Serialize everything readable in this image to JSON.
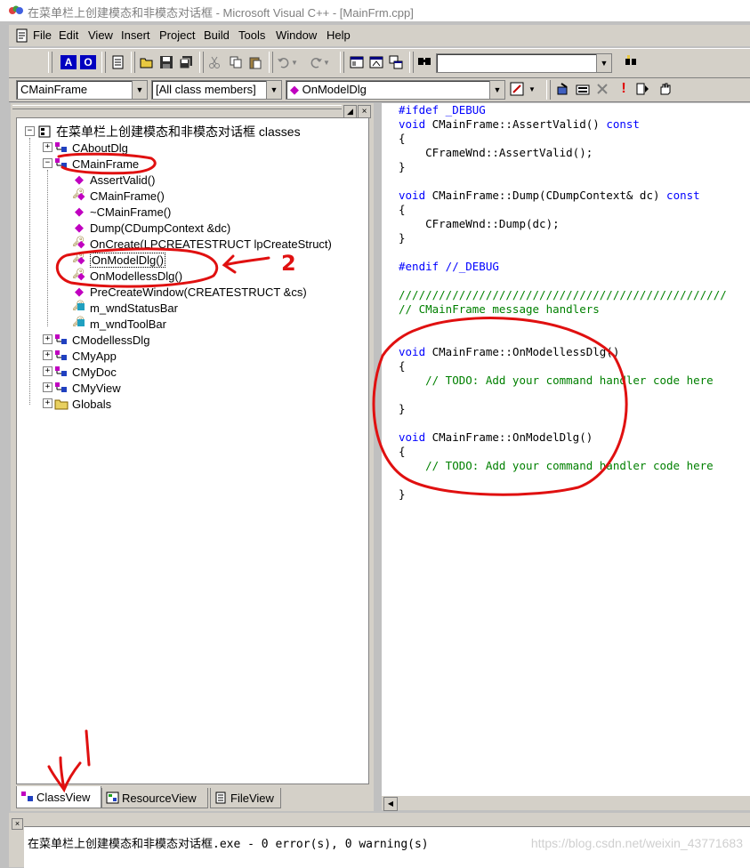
{
  "window": {
    "title": "在菜单栏上创建模态和非模态对话框 - Microsoft Visual C++ - [MainFrm.cpp]"
  },
  "menubar": {
    "items": [
      "File",
      "Edit",
      "View",
      "Insert",
      "Project",
      "Build",
      "Tools",
      "Window",
      "Help"
    ]
  },
  "wizardbar": {
    "class_combo": "CMainFrame",
    "filter_combo": "[All class members]",
    "member_combo": "OnModelDlg"
  },
  "tree": {
    "root": "在菜单栏上创建模态和非模态对话框 classes",
    "classes": {
      "about": "CAboutDlg",
      "mainframe": "CMainFrame",
      "modeless": "CModellessDlg",
      "app": "CMyApp",
      "doc": "CMyDoc",
      "view": "CMyView",
      "globals": "Globals"
    },
    "members": [
      "AssertValid()",
      "CMainFrame()",
      "~CMainFrame()",
      "Dump(CDumpContext &dc)",
      "OnCreate(LPCREATESTRUCT lpCreateStruct)",
      "OnModelDlg()",
      "OnModellessDlg()",
      "PreCreateWindow(CREATESTRUCT &cs)",
      "m_wndStatusBar",
      "m_wndToolBar"
    ]
  },
  "tabs": [
    "ClassView",
    "ResourceView",
    "FileView"
  ],
  "code": {
    "l1": "#ifdef _DEBUG",
    "l2a": "void",
    "l2b": " CMainFrame::AssertValid() ",
    "l2c": "const",
    "l3": "{",
    "l4": "    CFrameWnd::AssertValid();",
    "l5": "}",
    "l6a": "void",
    "l6b": " CMainFrame::Dump(CDumpContext& dc) ",
    "l6c": "const",
    "l7": "{",
    "l8": "    CFrameWnd::Dump(dc);",
    "l9": "}",
    "l10": "#endif //_DEBUG",
    "l11": "/////////////////////////////////////////////////",
    "l12": "// CMainFrame message handlers",
    "l13a": "void",
    "l13b": " CMainFrame::OnModellessDlg()",
    "l14": "{",
    "l15": "    // TODO: Add your command handler code here",
    "l16": "}",
    "l17a": "void",
    "l17b": " CMainFrame::OnModelDlg()",
    "l18": "{",
    "l19": "    // TODO: Add your command handler code here",
    "l20": "}"
  },
  "output": {
    "text": "在菜单栏上创建模态和非模态对话框.exe - 0 error(s), 0 warning(s)",
    "watermark": "https://blog.csdn.net/weixin_43771683"
  },
  "annotations": {
    "one": "1",
    "two": "2"
  },
  "colors": {
    "keyword": "#0000ff",
    "comment": "#008000",
    "annotation": "#e01010"
  }
}
